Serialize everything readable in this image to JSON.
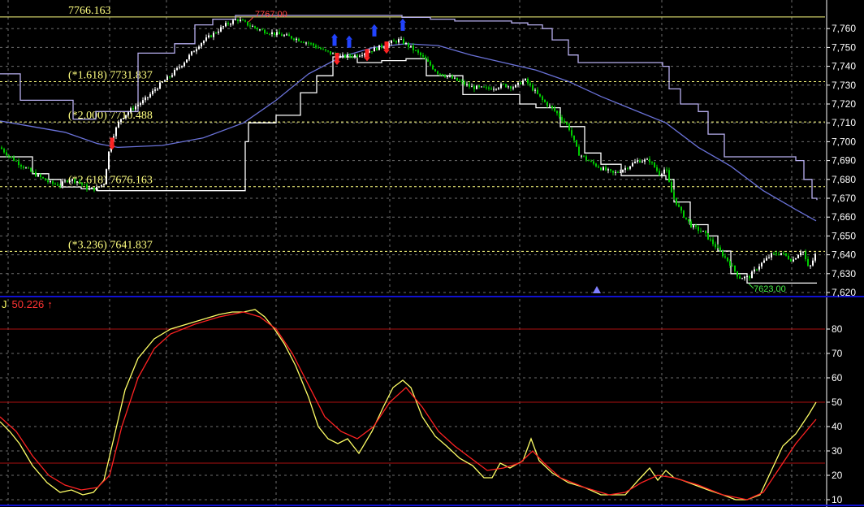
{
  "colors": {
    "background": "#000000",
    "grid": "#6e6e6e",
    "candle_up": "#ffffff",
    "candle_down": "#00cc00",
    "stop_line": "#ffffff",
    "channel_upper": "#b8b0f0",
    "moving_average": "#6a72d8",
    "fib_line": "#ffff80",
    "fib_text": "#ffff80",
    "panel_divider": "#1010d0",
    "j_line": "#ffff66",
    "j_signal": "#ff2222",
    "level_line": "#aa1111",
    "buy_marker": "#ff2222",
    "sell_marker": "#2244ff",
    "triangle": "#8080ff"
  },
  "chart_data": [
    {
      "type": "candlestick",
      "panel": "price",
      "ylim": [
        7620,
        7770
      ],
      "y_ticks": [
        "7,620",
        "7,630",
        "7,640",
        "7,650",
        "7,660",
        "7,670",
        "7,680",
        "7,690",
        "7,700",
        "7,710",
        "7,720",
        "7,730",
        "7,740",
        "7,750",
        "7,760"
      ],
      "grid": true,
      "fib_levels": [
        {
          "value": 7766.163,
          "label": "7766.163"
        },
        {
          "value": 7731.837,
          "label": "(*1.618) 7731.837"
        },
        {
          "value": 7710.488,
          "label": "(*2.000) 7710.488"
        },
        {
          "value": 7676.163,
          "label": "(*2.618) 7676.163"
        },
        {
          "value": 7641.837,
          "label": "(*3.236) 7641.837"
        }
      ],
      "high_annotation": {
        "value": 7767.0,
        "label": "7767.00"
      },
      "low_annotation": {
        "value": 7623.0,
        "label": "7623.00"
      },
      "close_path": [
        [
          0,
          7697
        ],
        [
          12,
          7692
        ],
        [
          25,
          7688
        ],
        [
          38,
          7684
        ],
        [
          50,
          7681
        ],
        [
          62,
          7678
        ],
        [
          74,
          7677
        ],
        [
          84,
          7680
        ],
        [
          96,
          7679
        ],
        [
          108,
          7675
        ],
        [
          118,
          7675
        ],
        [
          128,
          7678
        ],
        [
          136,
          7700
        ],
        [
          148,
          7712
        ],
        [
          164,
          7718
        ],
        [
          178,
          7722
        ],
        [
          196,
          7730
        ],
        [
          210,
          7735
        ],
        [
          226,
          7742
        ],
        [
          246,
          7752
        ],
        [
          262,
          7757
        ],
        [
          278,
          7762
        ],
        [
          292,
          7765
        ],
        [
          306,
          7762
        ],
        [
          322,
          7759
        ],
        [
          342,
          7757
        ],
        [
          362,
          7755
        ],
        [
          382,
          7752
        ],
        [
          400,
          7748
        ],
        [
          420,
          7745
        ],
        [
          440,
          7746
        ],
        [
          460,
          7749
        ],
        [
          478,
          7752
        ],
        [
          492,
          7754
        ],
        [
          506,
          7750
        ],
        [
          520,
          7745
        ],
        [
          538,
          7737
        ],
        [
          560,
          7733
        ],
        [
          580,
          7729
        ],
        [
          600,
          7728
        ],
        [
          620,
          7730
        ],
        [
          634,
          7729
        ],
        [
          646,
          7733
        ],
        [
          656,
          7728
        ],
        [
          668,
          7722
        ],
        [
          684,
          7716
        ],
        [
          700,
          7708
        ],
        [
          712,
          7694
        ],
        [
          724,
          7690
        ],
        [
          740,
          7686
        ],
        [
          756,
          7683
        ],
        [
          770,
          7686
        ],
        [
          786,
          7690
        ],
        [
          800,
          7690
        ],
        [
          812,
          7683
        ],
        [
          820,
          7686
        ],
        [
          826,
          7674
        ],
        [
          838,
          7663
        ],
        [
          852,
          7655
        ],
        [
          866,
          7652
        ],
        [
          876,
          7647
        ],
        [
          886,
          7642
        ],
        [
          898,
          7636
        ],
        [
          910,
          7628
        ],
        [
          922,
          7628
        ],
        [
          934,
          7634
        ],
        [
          950,
          7640
        ],
        [
          962,
          7641
        ],
        [
          976,
          7637
        ],
        [
          988,
          7643
        ],
        [
          996,
          7632
        ],
        [
          1006,
          7642
        ]
      ],
      "moving_average": [
        [
          0,
          7711
        ],
        [
          40,
          7708
        ],
        [
          80,
          7705
        ],
        [
          120,
          7699
        ],
        [
          145,
          7697
        ],
        [
          200,
          7698
        ],
        [
          250,
          7702
        ],
        [
          300,
          7710
        ],
        [
          340,
          7722
        ],
        [
          380,
          7736
        ],
        [
          420,
          7745
        ],
        [
          460,
          7750
        ],
        [
          500,
          7752
        ],
        [
          540,
          7751
        ],
        [
          580,
          7746
        ],
        [
          620,
          7742
        ],
        [
          660,
          7738
        ],
        [
          700,
          7732
        ],
        [
          740,
          7724
        ],
        [
          780,
          7717
        ],
        [
          820,
          7710
        ],
        [
          860,
          7697
        ],
        [
          900,
          7687
        ],
        [
          940,
          7674
        ],
        [
          980,
          7664
        ],
        [
          1005,
          7658
        ]
      ],
      "upper_channel": [
        [
          0,
          7736
        ],
        [
          10,
          7736
        ],
        [
          25,
          7722
        ],
        [
          65,
          7722
        ],
        [
          90,
          7712
        ],
        [
          112,
          7712
        ],
        [
          118,
          7716
        ],
        [
          138,
          7716
        ],
        [
          170,
          7747
        ],
        [
          190,
          7747
        ],
        [
          215,
          7752
        ],
        [
          240,
          7762
        ],
        [
          262,
          7765
        ],
        [
          290,
          7767
        ],
        [
          480,
          7767
        ],
        [
          495,
          7766
        ],
        [
          530,
          7765
        ],
        [
          560,
          7764
        ],
        [
          600,
          7764
        ],
        [
          630,
          7763
        ],
        [
          650,
          7762
        ],
        [
          668,
          7760
        ],
        [
          680,
          7754
        ],
        [
          700,
          7746
        ],
        [
          712,
          7742
        ],
        [
          730,
          7742
        ],
        [
          800,
          7742
        ],
        [
          816,
          7740
        ],
        [
          824,
          7728
        ],
        [
          838,
          7720
        ],
        [
          860,
          7716
        ],
        [
          872,
          7704
        ],
        [
          892,
          7692
        ],
        [
          960,
          7692
        ],
        [
          980,
          7690
        ],
        [
          990,
          7680
        ],
        [
          1000,
          7670
        ],
        [
          1006,
          7669
        ]
      ],
      "stop_line": [
        [
          0,
          7692
        ],
        [
          40,
          7683
        ],
        [
          60,
          7680
        ],
        [
          75,
          7676
        ],
        [
          100,
          7675
        ],
        [
          120,
          7674
        ],
        [
          300,
          7674
        ],
        [
          302,
          7700
        ],
        [
          306,
          7710
        ],
        [
          340,
          7714
        ],
        [
          370,
          7726
        ],
        [
          390,
          7735
        ],
        [
          410,
          7745
        ],
        [
          440,
          7742
        ],
        [
          470,
          7743
        ],
        [
          500,
          7744
        ],
        [
          525,
          7735
        ],
        [
          570,
          7725
        ],
        [
          640,
          7720
        ],
        [
          660,
          7718
        ],
        [
          690,
          7708
        ],
        [
          720,
          7694
        ],
        [
          740,
          7688
        ],
        [
          765,
          7682
        ],
        [
          820,
          7680
        ],
        [
          830,
          7668
        ],
        [
          850,
          7656
        ],
        [
          872,
          7650
        ],
        [
          884,
          7642
        ],
        [
          900,
          7630
        ],
        [
          920,
          7625
        ],
        [
          1006,
          7625
        ]
      ],
      "buy_markers": [
        [
          138,
          7700
        ],
        [
          415,
          7745
        ],
        [
          452,
          7747
        ],
        [
          476,
          7751
        ]
      ],
      "sell_markers": [
        [
          412,
          7753
        ],
        [
          430,
          7752
        ],
        [
          461,
          7758
        ],
        [
          496,
          7761
        ]
      ],
      "triangle_marker_x": 735
    },
    {
      "type": "line",
      "panel": "indicator",
      "title": "J",
      "current_value": "50.226",
      "arrow": "↑",
      "ylim": [
        7,
        87
      ],
      "y_ticks": [
        "10",
        "20",
        "30",
        "40",
        "50",
        "60",
        "70",
        "80"
      ],
      "levels": [
        25,
        50,
        80
      ],
      "grid": true,
      "series": [
        {
          "role": "J",
          "values": [
            [
              0,
              42
            ],
            [
              12,
              38
            ],
            [
              24,
              33
            ],
            [
              40,
              24
            ],
            [
              58,
              17
            ],
            [
              74,
              13
            ],
            [
              88,
              14
            ],
            [
              102,
              12
            ],
            [
              115,
              13
            ],
            [
              128,
              18
            ],
            [
              140,
              35
            ],
            [
              154,
              55
            ],
            [
              170,
              68
            ],
            [
              190,
              76
            ],
            [
              210,
              80
            ],
            [
              230,
              82
            ],
            [
              250,
              84
            ],
            [
              270,
              86
            ],
            [
              286,
              87
            ],
            [
              300,
              87
            ],
            [
              314,
              88
            ],
            [
              326,
              85
            ],
            [
              338,
              80
            ],
            [
              350,
              74
            ],
            [
              364,
              65
            ],
            [
              380,
              52
            ],
            [
              392,
              40
            ],
            [
              404,
              35
            ],
            [
              416,
              33
            ],
            [
              428,
              35
            ],
            [
              442,
              29
            ],
            [
              458,
              38
            ],
            [
              472,
              48
            ],
            [
              484,
              56
            ],
            [
              496,
              59
            ],
            [
              506,
              56
            ],
            [
              520,
              44
            ],
            [
              536,
              36
            ],
            [
              550,
              32
            ],
            [
              566,
              27
            ],
            [
              582,
              24
            ],
            [
              596,
              19
            ],
            [
              606,
              19
            ],
            [
              616,
              25
            ],
            [
              628,
              23
            ],
            [
              644,
              26
            ],
            [
              654,
              35
            ],
            [
              664,
              26
            ],
            [
              680,
              21
            ],
            [
              700,
              17
            ],
            [
              720,
              15
            ],
            [
              740,
              12
            ],
            [
              756,
              12
            ],
            [
              770,
              12
            ],
            [
              786,
              18
            ],
            [
              800,
              23
            ],
            [
              810,
              18
            ],
            [
              820,
              22
            ],
            [
              830,
              19
            ],
            [
              840,
              18
            ],
            [
              856,
              16
            ],
            [
              872,
              14
            ],
            [
              890,
              12
            ],
            [
              906,
              10
            ],
            [
              920,
              10
            ],
            [
              936,
              12
            ],
            [
              950,
              22
            ],
            [
              964,
              32
            ],
            [
              980,
              37
            ],
            [
              996,
              45
            ],
            [
              1005,
              50
            ]
          ]
        },
        {
          "role": "signal",
          "values": [
            [
              0,
              44
            ],
            [
              20,
              38
            ],
            [
              40,
              28
            ],
            [
              60,
              20
            ],
            [
              80,
              16
            ],
            [
              100,
              14
            ],
            [
              120,
              15
            ],
            [
              135,
              20
            ],
            [
              150,
              40
            ],
            [
              170,
              60
            ],
            [
              190,
              72
            ],
            [
              210,
              78
            ],
            [
              240,
              82
            ],
            [
              270,
              85
            ],
            [
              300,
              87
            ],
            [
              320,
              85
            ],
            [
              340,
              80
            ],
            [
              360,
              70
            ],
            [
              380,
              57
            ],
            [
              400,
              44
            ],
            [
              420,
              38
            ],
            [
              440,
              35
            ],
            [
              460,
              40
            ],
            [
              480,
              50
            ],
            [
              500,
              56
            ],
            [
              520,
              48
            ],
            [
              540,
              38
            ],
            [
              560,
              32
            ],
            [
              580,
              27
            ],
            [
              600,
              22
            ],
            [
              620,
              23
            ],
            [
              640,
              25
            ],
            [
              656,
              30
            ],
            [
              670,
              25
            ],
            [
              690,
              19
            ],
            [
              720,
              15
            ],
            [
              750,
              12
            ],
            [
              770,
              13
            ],
            [
              790,
              17
            ],
            [
              810,
              20
            ],
            [
              830,
              19
            ],
            [
              860,
              16
            ],
            [
              890,
              12
            ],
            [
              920,
              10
            ],
            [
              940,
              13
            ],
            [
              960,
              23
            ],
            [
              980,
              33
            ],
            [
              1000,
              41
            ],
            [
              1005,
              43
            ]
          ]
        }
      ]
    }
  ]
}
